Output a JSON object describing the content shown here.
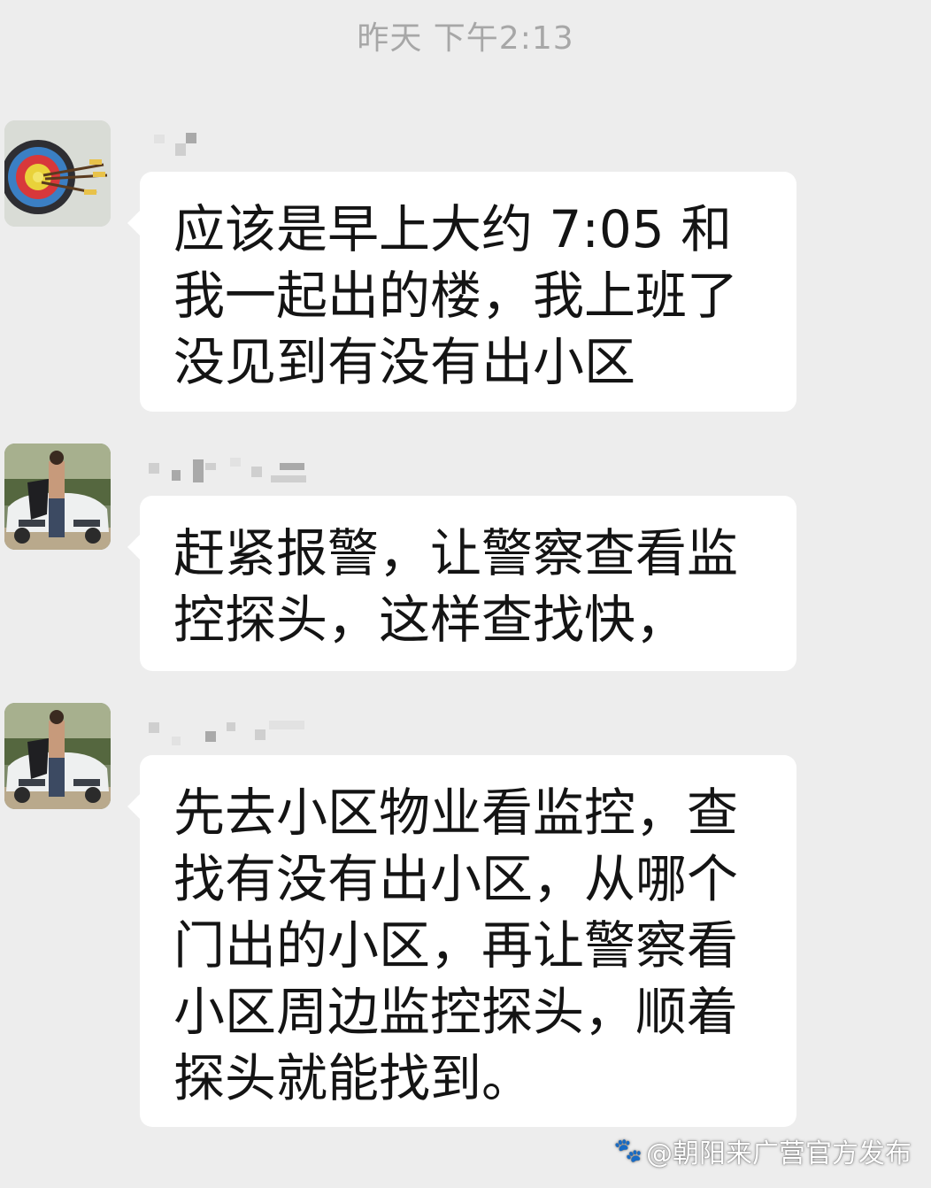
{
  "timestamp": "昨天 下午2:13",
  "messages": [
    {
      "avatar": "archery-target-avatar",
      "text": "应该是早上大约 7:05 和我一起出的楼，我上班了没见到有没有出小区"
    },
    {
      "avatar": "man-with-car-avatar",
      "text": "赶紧报警，让警察查看监控探头，这样查找快，"
    },
    {
      "avatar": "man-with-car-avatar",
      "text": "先去小区物业看监控，查找有没有出小区，从哪个门出的小区，再让警察看小区周边监控探头，顺着探头就能找到。"
    }
  ],
  "watermark": {
    "icon": "paw-icon",
    "text": "@朝阳来广营官方发布"
  }
}
